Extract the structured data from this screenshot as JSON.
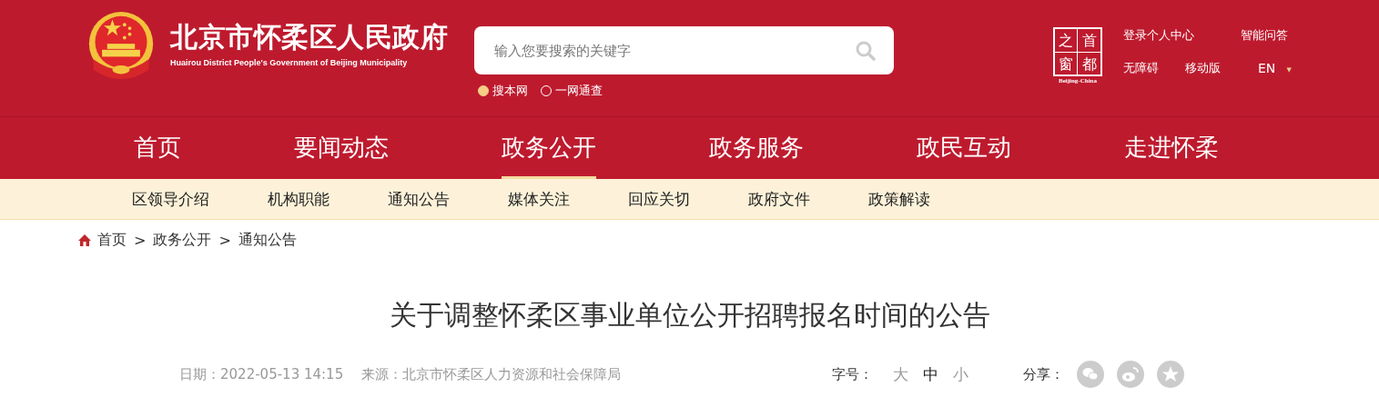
{
  "header": {
    "site_title": "北京市怀柔区人民政府",
    "site_subtitle": "Huairou District People's Government of Beijing Municipality",
    "search": {
      "placeholder": "输入您要搜索的关键字"
    },
    "search_scopes": [
      {
        "label": "搜本网",
        "selected": true
      },
      {
        "label": "一网通查",
        "selected": false
      }
    ],
    "capital_logo": {
      "chars": [
        "之",
        "首",
        "窗",
        "都"
      ],
      "caption": "Beijing-China"
    },
    "links": [
      {
        "label": "登录个人中心"
      },
      {
        "label": "智能问答"
      },
      {
        "label": "无障碍"
      },
      {
        "label": "移动版"
      }
    ],
    "language": {
      "label": "EN",
      "caret": "▼"
    }
  },
  "nav": [
    {
      "label": "首页",
      "selected": false
    },
    {
      "label": "要闻动态",
      "selected": false
    },
    {
      "label": "政务公开",
      "selected": true
    },
    {
      "label": "政务服务",
      "selected": false
    },
    {
      "label": "政民互动",
      "selected": false
    },
    {
      "label": "走进怀柔",
      "selected": false
    }
  ],
  "subnav": [
    "区领导介绍",
    "机构职能",
    "通知公告",
    "媒体关注",
    "回应关切",
    "政府文件",
    "政策解读"
  ],
  "breadcrumb": [
    "首页",
    "政务公开",
    "通知公告"
  ],
  "breadcrumb_separator": ">",
  "article": {
    "title": "关于调整怀柔区事业单位公开招聘报名时间的公告",
    "date": "日期：2022-05-13 14:15",
    "source": "来源：北京市怀柔区人力资源和社会保障局",
    "font_size_label": "字号：",
    "font_sizes": [
      {
        "label": "大",
        "selected": false
      },
      {
        "label": "中",
        "selected": true
      },
      {
        "label": "小",
        "selected": false
      }
    ],
    "share_label": "分享：",
    "share": [
      {
        "kind": "wechat"
      },
      {
        "kind": "weibo"
      },
      {
        "kind": "qzone"
      }
    ]
  }
}
